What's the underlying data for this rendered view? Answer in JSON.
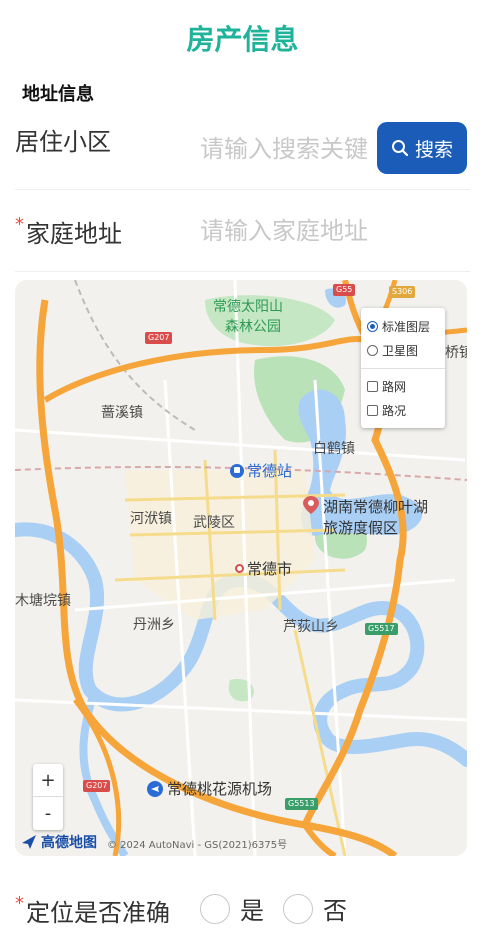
{
  "header": {
    "title": "房产信息"
  },
  "section": {
    "title": "地址信息"
  },
  "community": {
    "label": "居住小区",
    "placeholder": "请输入搜索关键",
    "search_label": "搜索"
  },
  "address": {
    "required_mark": "*",
    "label": "家庭地址",
    "placeholder": "请输入家庭地址"
  },
  "map": {
    "layer_options": {
      "standard": "标准图层",
      "satellite": "卫星图",
      "roads": "路网",
      "traffic": "路况"
    },
    "selected_layer": "标准图层",
    "zoom_in": "+",
    "zoom_out": "-",
    "brand": "高德地图",
    "copyright": "© 2024 AutoNavi - GS(2021)6375号",
    "places": {
      "park": "常德太阳山",
      "park2": "森林公园",
      "town1": "蔷溪镇",
      "town2": "白鹤镇",
      "station": "常德站",
      "lake1": "湖南常德柳叶湖",
      "lake2": "旅游度假区",
      "town3": "河洑镇",
      "district": "武陵区",
      "city": "常德市",
      "town4": "木塘垸镇",
      "town5": "丹洲乡",
      "town6": "芦荻山乡",
      "airport": "常德桃花源机场",
      "edge": "桥镇"
    },
    "shields": {
      "g55": "G55",
      "s306": "S306",
      "g207": "G207",
      "g207b": "G207",
      "g5513": "G5513",
      "g5517": "G5517"
    }
  },
  "accuracy": {
    "required_mark": "*",
    "label": "定位是否准确",
    "yes": "是",
    "no": "否"
  },
  "colors": {
    "accent": "#1fb39a",
    "button": "#1a5cb8",
    "required": "#e54d42",
    "highway": "#f6a53a"
  }
}
